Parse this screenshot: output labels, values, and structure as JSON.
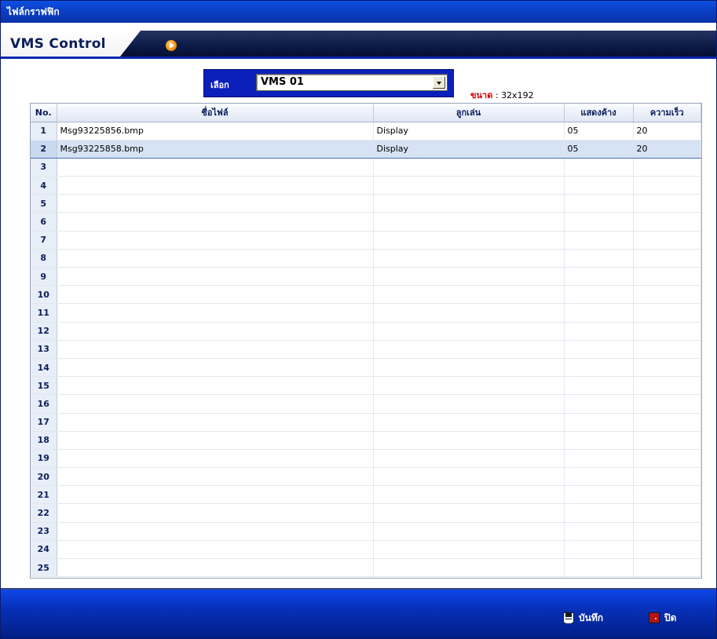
{
  "window": {
    "title": "ไฟล์กราฟฟิก"
  },
  "header": {
    "title": "VMS Control",
    "play_icon": "play-circle-icon"
  },
  "selector": {
    "label": "เลือก",
    "value": "VMS 01"
  },
  "size_info": {
    "label": "ขนาด",
    "separator": " : ",
    "value": "32x192"
  },
  "table": {
    "columns": [
      "No.",
      "ชื่อไฟล์",
      "ลูกเล่น",
      "แสดงค้าง",
      "ความเร็ว"
    ],
    "rows": [
      {
        "no": "1",
        "file": "Msg93225856.bmp",
        "effect": "Display",
        "hold": "05",
        "speed": "20"
      },
      {
        "no": "2",
        "file": "Msg93225858.bmp",
        "effect": "Display",
        "hold": "05",
        "speed": "20"
      },
      {
        "no": "3",
        "file": "",
        "effect": "",
        "hold": "",
        "speed": ""
      },
      {
        "no": "4",
        "file": "",
        "effect": "",
        "hold": "",
        "speed": ""
      },
      {
        "no": "5",
        "file": "",
        "effect": "",
        "hold": "",
        "speed": ""
      },
      {
        "no": "6",
        "file": "",
        "effect": "",
        "hold": "",
        "speed": ""
      },
      {
        "no": "7",
        "file": "",
        "effect": "",
        "hold": "",
        "speed": ""
      },
      {
        "no": "8",
        "file": "",
        "effect": "",
        "hold": "",
        "speed": ""
      },
      {
        "no": "9",
        "file": "",
        "effect": "",
        "hold": "",
        "speed": ""
      },
      {
        "no": "10",
        "file": "",
        "effect": "",
        "hold": "",
        "speed": ""
      },
      {
        "no": "11",
        "file": "",
        "effect": "",
        "hold": "",
        "speed": ""
      },
      {
        "no": "12",
        "file": "",
        "effect": "",
        "hold": "",
        "speed": ""
      },
      {
        "no": "13",
        "file": "",
        "effect": "",
        "hold": "",
        "speed": ""
      },
      {
        "no": "14",
        "file": "",
        "effect": "",
        "hold": "",
        "speed": ""
      },
      {
        "no": "15",
        "file": "",
        "effect": "",
        "hold": "",
        "speed": ""
      },
      {
        "no": "16",
        "file": "",
        "effect": "",
        "hold": "",
        "speed": ""
      },
      {
        "no": "17",
        "file": "",
        "effect": "",
        "hold": "",
        "speed": ""
      },
      {
        "no": "18",
        "file": "",
        "effect": "",
        "hold": "",
        "speed": ""
      },
      {
        "no": "19",
        "file": "",
        "effect": "",
        "hold": "",
        "speed": ""
      },
      {
        "no": "20",
        "file": "",
        "effect": "",
        "hold": "",
        "speed": ""
      },
      {
        "no": "21",
        "file": "",
        "effect": "",
        "hold": "",
        "speed": ""
      },
      {
        "no": "22",
        "file": "",
        "effect": "",
        "hold": "",
        "speed": ""
      },
      {
        "no": "23",
        "file": "",
        "effect": "",
        "hold": "",
        "speed": ""
      },
      {
        "no": "24",
        "file": "",
        "effect": "",
        "hold": "",
        "speed": ""
      },
      {
        "no": "25",
        "file": "",
        "effect": "",
        "hold": "",
        "speed": ""
      }
    ],
    "selected_row": 2
  },
  "footer": {
    "save": {
      "label": "บันทึก",
      "icon": "floppy-disk-icon"
    },
    "close": {
      "label": "ปิด",
      "icon": "door-exit-icon"
    }
  },
  "colors": {
    "title_bar": "#0a3fc6",
    "header_dark": "#0c1a47",
    "selector_bg": "#0b1fbb",
    "size_label": "#d40000",
    "footer": "#0730b8",
    "selected_row": "#d5e3f5"
  }
}
